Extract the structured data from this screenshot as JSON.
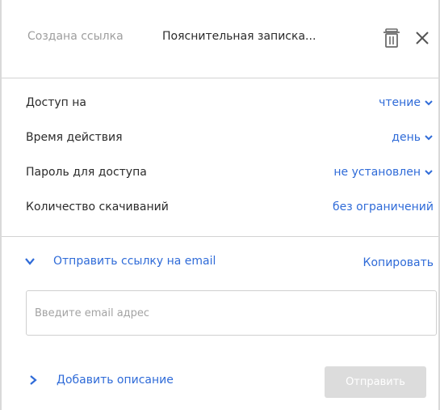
{
  "header": {
    "created_label": "Создана ссылка",
    "file_name": "Пояснительная записка...",
    "delete_icon": "trash-icon",
    "close_icon": "close-icon"
  },
  "settings": {
    "rows": [
      {
        "label": "Доступ на",
        "value": "чтение",
        "has_dropdown": true
      },
      {
        "label": "Время действия",
        "value": "день",
        "has_dropdown": true
      },
      {
        "label": "Пароль для доступа",
        "value": "не установлен",
        "has_dropdown": true
      },
      {
        "label": "Количество скачиваний",
        "value": "без ограничений",
        "has_dropdown": false
      }
    ]
  },
  "email": {
    "toggle_label": "Отправить ссылку на email",
    "toggle_icon": "chevron-down-icon",
    "copy_label": "Копировать",
    "input_placeholder": "Введите email адрес",
    "input_value": ""
  },
  "description": {
    "toggle_label": "Добавить описание",
    "toggle_icon": "chevron-right-icon"
  },
  "send_button_label": "Отправить",
  "colors": {
    "accent": "#2f6bd8",
    "muted_text": "#9e9e9e",
    "divider": "#d3d3d3",
    "disabled_button": "#dcdcdc"
  }
}
